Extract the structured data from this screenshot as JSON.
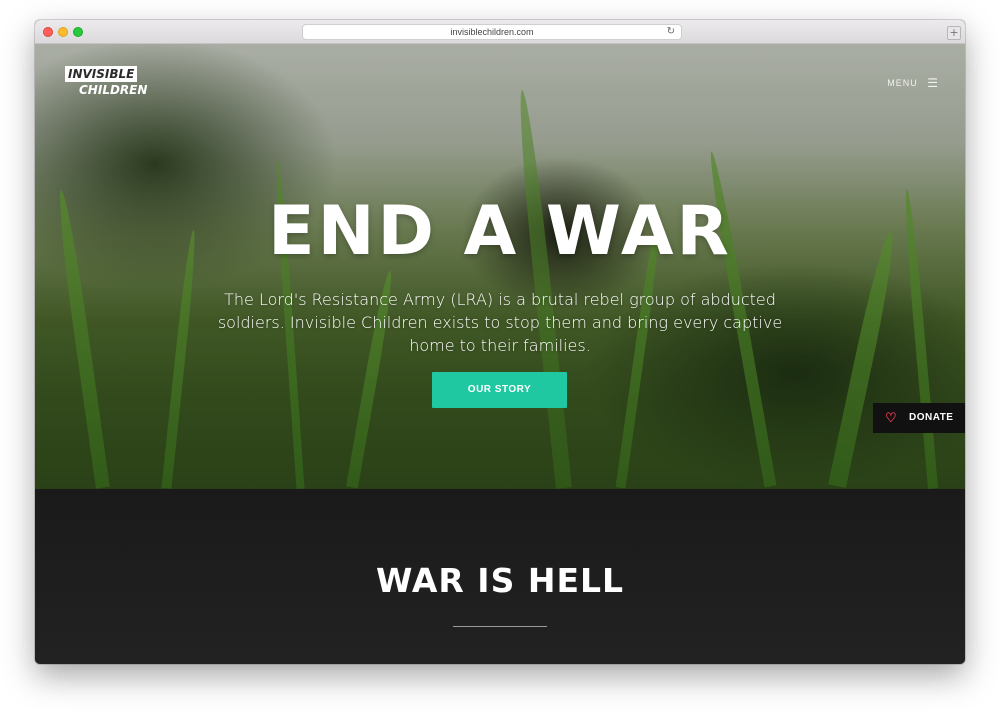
{
  "browser": {
    "url": "invisiblechildren.com",
    "reload_icon": "reload-icon",
    "new_tab_icon": "plus-icon"
  },
  "header": {
    "logo_line1": "INVISIBLE",
    "logo_line2": "CHILDREN",
    "menu_label": "MENU",
    "menu_icon": "hamburger-icon"
  },
  "hero": {
    "headline": "END A WAR",
    "intro": "The Lord's Resistance Army (LRA) is a brutal rebel group of abducted soldiers. Invisible Children exists to stop them and bring every captive home to their families.",
    "cta_label": "OUR STORY"
  },
  "donate": {
    "label": "DONATE",
    "icon": "heart-icon"
  },
  "section": {
    "title": "WAR IS HELL"
  },
  "colors": {
    "accent": "#1fc8a0",
    "donate_heart": "#e0384a",
    "dark_section": "#1b1b1b"
  }
}
